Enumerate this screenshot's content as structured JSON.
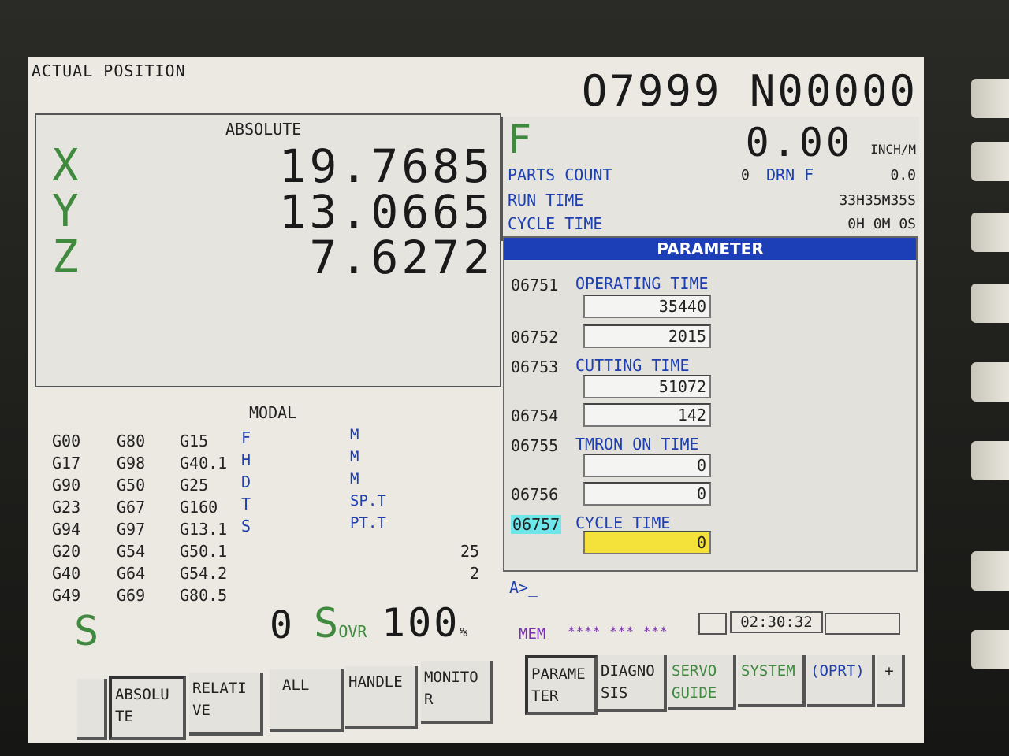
{
  "header": {
    "title": "ACTUAL POSITION",
    "program": "O7999 N00000"
  },
  "position": {
    "label": "ABSOLUTE",
    "axes": [
      {
        "axis": "X",
        "value": "19.7685"
      },
      {
        "axis": "Y",
        "value": "13.0665"
      },
      {
        "axis": "Z",
        "value": "7.6272"
      }
    ]
  },
  "feed": {
    "letter": "F",
    "value": "0.00",
    "unit": "INCH/M"
  },
  "info": {
    "parts_count_label": "PARTS COUNT",
    "parts_count": "0",
    "drn_label": "DRN F",
    "drn": "0.0",
    "run_time_label": "RUN TIME",
    "run_time": "33H35M35S",
    "cycle_time_label": "CYCLE TIME",
    "cycle_time": "0H 0M 0S"
  },
  "parameter": {
    "title": "PARAMETER",
    "rows": [
      {
        "num": "06751",
        "name": "OPERATING TIME",
        "value": "35440"
      },
      {
        "num": "06752",
        "name": "",
        "value": "2015"
      },
      {
        "num": "06753",
        "name": "CUTTING TIME",
        "value": "51072"
      },
      {
        "num": "06754",
        "name": "",
        "value": "142"
      },
      {
        "num": "06755",
        "name": "TMRON ON TIME",
        "value": "0"
      },
      {
        "num": "06756",
        "name": "",
        "value": "0"
      },
      {
        "num": "06757",
        "name": "CYCLE TIME",
        "value": "0"
      }
    ]
  },
  "modal": {
    "title": "MODAL",
    "col1": [
      "G00",
      "G17",
      "G90",
      "G23",
      "G94",
      "G20",
      "G40",
      "G49"
    ],
    "col2": [
      "G80",
      "G98",
      "G50",
      "G67",
      "G97",
      "G54",
      "G64",
      "G69"
    ],
    "col3": [
      "G15",
      "G40.1",
      "G25",
      "G160",
      "G13.1",
      "G50.1",
      "G54.2",
      "G80.5"
    ],
    "addr": [
      "F",
      "H",
      "D",
      "T",
      "S"
    ],
    "m": [
      "M",
      "M",
      "M"
    ],
    "sp_label": "SP.T",
    "sp_value": "25",
    "pt_label": "PT.T",
    "pt_value": "2"
  },
  "spindle": {
    "letter": "S",
    "value": "0",
    "ovr_letter": "S",
    "ovr_label": "OVR",
    "ovr_value": "100",
    "ovr_unit": "%"
  },
  "prompt": "A>_",
  "status": {
    "mode": "MEM",
    "stars": "**** *** ***",
    "time": "02:30:32"
  },
  "softkeys": [
    {
      "l1": "ABSOLU",
      "l2": "TE"
    },
    {
      "l1": "RELATI",
      "l2": "VE"
    },
    {
      "l1": "ALL",
      "l2": ""
    },
    {
      "l1": "HANDLE",
      "l2": ""
    },
    {
      "l1": "MONITO",
      "l2": "R"
    },
    {
      "l1": "PARAME",
      "l2": "TER"
    },
    {
      "l1": "DIAGNO",
      "l2": "SIS"
    },
    {
      "l1": "SERVO",
      "l2": "GUIDE"
    },
    {
      "l1": "SYSTEM",
      "l2": ""
    },
    {
      "l1": "(OPRT)",
      "l2": ""
    },
    {
      "l1": "+",
      "l2": ""
    }
  ]
}
